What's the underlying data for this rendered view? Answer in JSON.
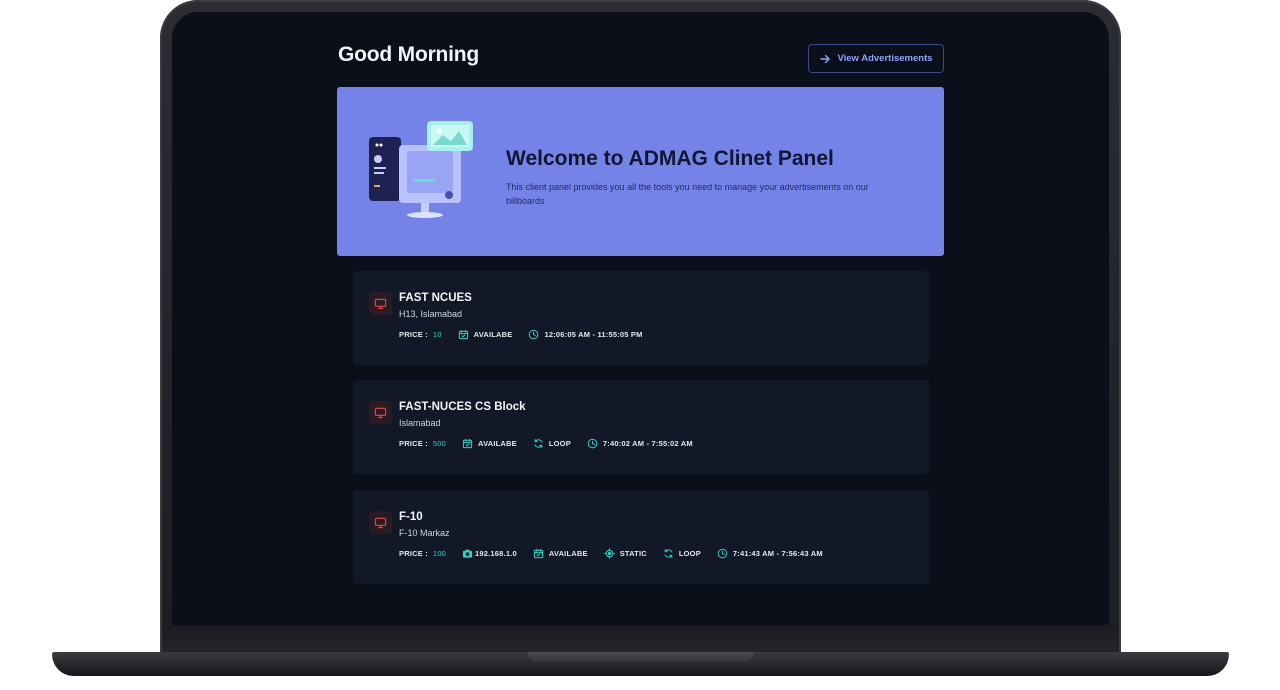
{
  "header": {
    "greeting": "Good Morning",
    "view_ads_label": "View Advertisements"
  },
  "hero": {
    "title": "Welcome to ADMAG Clinet Panel",
    "description": "This client panel provides you all the tools you need to manage your advertisements on our billboards"
  },
  "billboards": [
    {
      "name": "FAST NCUES",
      "location": "H13, Islamabad",
      "price_label": "PRICE :",
      "price": "10",
      "availability": "AVAILABE",
      "time": "12:06:05 AM - 11:55:05 PM"
    },
    {
      "name": "FAST-NUCES CS Block",
      "location": "Islamabad",
      "price_label": "PRICE :",
      "price": "500",
      "availability": "AVAILABE",
      "mode": "LOOP",
      "time": "7:40:02 AM - 7:55:02 AM"
    },
    {
      "name": "F-10",
      "location": "F-10 Markaz",
      "price_label": "PRICE :",
      "price": "100",
      "ip": "192.168.1.0",
      "availability": "AVAILABE",
      "type": "STATIC",
      "mode": "LOOP",
      "time": "7:41:43 AM - 7:56:43 AM"
    }
  ],
  "colors": {
    "background": "#0b0f19",
    "card": "#121827",
    "hero": "#7583e8",
    "accent_teal": "#2dd4bf",
    "accent_blue": "#8ea2ff",
    "icon_red": "#ef4444"
  },
  "icons": {
    "button": "arrow-right-icon",
    "card": "monitor-icon",
    "availability": "calendar-check-icon",
    "time": "clock-icon",
    "mode": "refresh-icon",
    "ip": "camera-icon",
    "type": "crosshair-icon"
  }
}
